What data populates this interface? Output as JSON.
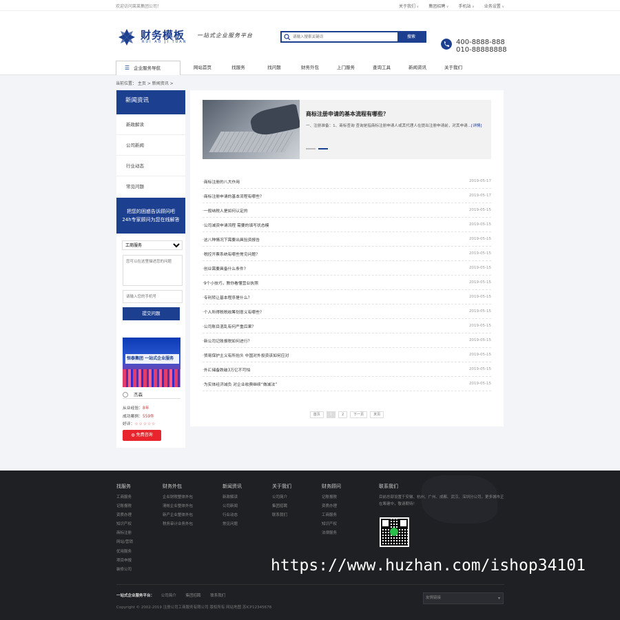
{
  "topbar": {
    "welcome": "欢迎访问莱莱集团公司！",
    "links": [
      "关于我们",
      "集团招聘",
      "手机站",
      "业务设置"
    ]
  },
  "logo": {
    "cn": "财务模板",
    "en": "RUI AO JI TUAN"
  },
  "slogan": "一站式企业服务平台",
  "search": {
    "placeholder": "请输入搜索关键词",
    "button": "搜索"
  },
  "phones": {
    "line1": "400-8888-888",
    "line2": "010-88888888"
  },
  "nav": {
    "category": "企业服务导航",
    "items": [
      "网站首页",
      "找服务",
      "找问题",
      "财务外包",
      "上门服务",
      "查询工具",
      "新闻资讯",
      "关于我们"
    ]
  },
  "breadcrumb": "当前位置： 主页 > 新闻资讯 >",
  "sidebar": {
    "title": "新闻资讯",
    "items": [
      "新政解读",
      "公司新闻",
      "行业动态",
      "常见问题"
    ],
    "consult_line1": "把您的困惑告诉顾问吧",
    "consult_line2": "24h专家顾问为您在线解答",
    "select_value": "工商服务",
    "textarea_placeholder": "您可以在这里描述您的问题",
    "phone_placeholder": "请输入您的手机号",
    "submit": "提交问题",
    "banner_text": "恒泰集团 一站式企业服务",
    "advisor_name": "杰森",
    "exp_label": "从业经验：",
    "exp_value": "8年",
    "cases_label": "成功案例：",
    "cases_value": "559件",
    "rating_label": "好评：",
    "rating_value": 5,
    "rating_stars": "☆☆☆☆☆",
    "free_btn": "免费咨询"
  },
  "feature": {
    "title": "商标注册申请的基本流程有哪些？",
    "desc": "一、注册准备：1、商标查询 查询是指商标注册申请人或其代理人在提出注册申请前，对其申请...",
    "more": "[详情]"
  },
  "news": [
    {
      "title": "商标注册的八大作用",
      "date": "2019-05-17"
    },
    {
      "title": "商标注册申请的基本流程有哪些？",
      "date": "2019-05-17"
    },
    {
      "title": "一般纳税人是如何认定的",
      "date": "2019-05-15"
    },
    {
      "title": "公司减资申请流程 需要的填写状态模",
      "date": "2019-05-15"
    },
    {
      "title": "这八种情况下需要出具验资报告",
      "date": "2019-05-15"
    },
    {
      "title": "税控开票系统有哪些常见问题？",
      "date": "2019-05-15"
    },
    {
      "title": "创业需要具备什么条件？",
      "date": "2019-05-15"
    },
    {
      "title": "9个小技巧，教你看懂营业执照",
      "date": "2019-05-15"
    },
    {
      "title": "专利转让基本程序是什么？",
      "date": "2019-05-15"
    },
    {
      "title": "个人所得税税收筹划意义有哪些？",
      "date": "2019-05-15"
    },
    {
      "title": "公司账目混乱有何严重后果？",
      "date": "2019-05-15"
    },
    {
      "title": "新公司记账报税如何进行？",
      "date": "2019-05-15"
    },
    {
      "title": "贸易保护主义有所抬头 中国对外投资该如何应对",
      "date": "2019-05-15"
    },
    {
      "title": "外汇储备跌破3万亿不可怕",
      "date": "2019-05-15"
    },
    {
      "title": "为实体经济减负 对企业收费继续“做减法”",
      "date": "2019-05-15"
    }
  ],
  "pager": [
    "首页",
    "1",
    "2",
    "下一页",
    "末页"
  ],
  "footer": {
    "cols": [
      {
        "title": "找服务",
        "items": [
          "工商服务",
          "记账报税",
          "资质办理",
          "知识产权",
          "商标注册",
          "网站/营销",
          "优用服务",
          "项目申报",
          "装修公司"
        ]
      },
      {
        "title": "财务外包",
        "items": [
          "企业财税整体外包",
          "清帐企业整体外包",
          "新产企业整体外包",
          "税务审计业务外包"
        ]
      },
      {
        "title": "新闻资讯",
        "items": [
          "新政解读",
          "公司新闻",
          "行业动态",
          "常见问题"
        ]
      },
      {
        "title": "关于我们",
        "items": [
          "公司简介",
          "集团招聘",
          "联系我们"
        ]
      },
      {
        "title": "财务顾问",
        "items": [
          "记账报税",
          "资质办理",
          "工商服务",
          "知识产权",
          "法律服务"
        ]
      }
    ],
    "contact_title": "联系我们",
    "contact_text": "目前总部设置于安徽、杭州、广州、成都、武汉、深圳分公司，更多城市正在筹建中，敬请期待！",
    "platform_label": "一站式企业服务平台：",
    "platform_links": [
      "公司简介",
      "集团招聘",
      "联系我们"
    ],
    "copyright": "Copyright © 2002-2019 注册公司工商服务有限公司 版权所有   网站地图   苏ICP12345678",
    "select_value": "友情链接"
  },
  "watermark": "https://www.huzhan.com/ishop34101",
  "colors": {
    "brand": "#1d3f8f",
    "accent": "#e8252d",
    "footer_bg": "#1f2024"
  }
}
